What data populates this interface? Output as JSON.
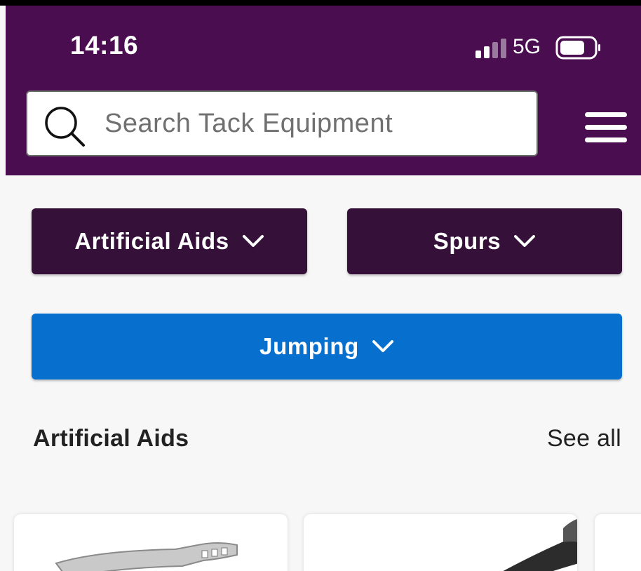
{
  "status_bar": {
    "time": "14:16",
    "network": "5G",
    "signal_icon": "cellular-signal-icon",
    "battery_icon": "battery-icon"
  },
  "search": {
    "placeholder": "Search Tack Equipment",
    "icon": "search-icon"
  },
  "menu_icon": "hamburger-menu-icon",
  "filters": [
    {
      "label": "Artificial Aids",
      "icon": "chevron-down-icon",
      "color": "#35113a"
    },
    {
      "label": "Spurs",
      "icon": "chevron-down-icon",
      "color": "#35113a"
    },
    {
      "label": "Jumping",
      "icon": "chevron-down-icon",
      "color": "#0770cf"
    }
  ],
  "section": {
    "title": "Artificial Aids",
    "see_all": "See all"
  },
  "colors": {
    "header": "#4a0d4f",
    "filter_dark": "#35113a",
    "filter_blue": "#0770cf",
    "background": "#f7f7f7"
  }
}
